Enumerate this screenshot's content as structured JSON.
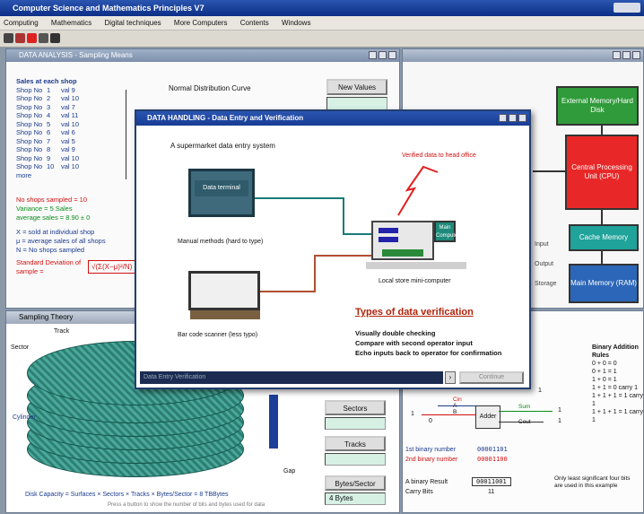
{
  "app": {
    "title": "Computer Science and Mathematics Principles V7"
  },
  "menu": [
    "Computing",
    "Mathematics",
    "Digital techniques",
    "More Computers",
    "Contents",
    "Windows"
  ],
  "left_window": {
    "title": "DATA ANALYSIS - Sampling Means",
    "sizes_header": "Sales at each shop",
    "steps": [
      {
        "label": "Shop No",
        "n": "1",
        "val": "val 9"
      },
      {
        "label": "Shop No",
        "n": "2",
        "val": "val 10"
      },
      {
        "label": "Shop No",
        "n": "3",
        "val": "val 7"
      },
      {
        "label": "Shop No",
        "n": "4",
        "val": "val 11"
      },
      {
        "label": "Shop No",
        "n": "5",
        "val": "val 10"
      },
      {
        "label": "Shop No",
        "n": "6",
        "val": "val 6"
      },
      {
        "label": "Shop No",
        "n": "7",
        "val": "val 5"
      },
      {
        "label": "Shop No",
        "n": "8",
        "val": "val 9"
      },
      {
        "label": "Shop No",
        "n": "9",
        "val": "val 10"
      },
      {
        "label": "Shop No",
        "n": "10",
        "val": "val 10"
      }
    ],
    "more": "more",
    "no_shops": "No shops sampled = 10",
    "variance": "Variance = 5 Sales",
    "average": "average sales = 8.90 ± 0",
    "def_x": "X = sold at individual shop",
    "def_mu": "μ = average sales of all shops",
    "def_n": "N = No shops sampled",
    "std_label": "Standard Deviation of sample =",
    "formula": "√(Σ(X−μ)²/N)",
    "chart_title": "Normal Distribution Curve",
    "new_values_button": "New Values"
  },
  "disk_window": {
    "title": "Sampling Theory",
    "sector_label": "Sector",
    "track_label": "Track",
    "cylinder_label": "Cylinder",
    "gap_label": "Gap",
    "formula": "Disk Capacity = Surfaces × Sectors × Tracks × Bytes/Sector = 8 TBBytes",
    "note": "Press a button to show the number of bits and bytes used for data",
    "buttons": [
      "Sectors",
      "Tracks",
      "Bytes/Sector"
    ],
    "bytes_field": "4 Bytes"
  },
  "cpu_window": {
    "blocks": [
      "External Memory/Hard Disk",
      "Central Processing Unit (CPU)",
      "Cache Memory",
      "Main Memory (RAM)"
    ],
    "side_labels": [
      "Input",
      "Output",
      "Storage"
    ]
  },
  "adder_window": {
    "binary_rules_title": "Binary Addition Rules",
    "rules": [
      "0 + 0 = 0",
      "0 + 1 = 1",
      "1 + 0 = 1",
      "1 + 1 = 0 carry 1",
      "1 + 1 + 1 = 1 carry 1",
      "1 + 1 + 1 = 1 carry 1"
    ],
    "adder_label": "Adder",
    "in_labels": [
      "Cin",
      "A",
      "B"
    ],
    "out_labels": [
      "Sum",
      "Cout"
    ],
    "bit_values": [
      "1",
      "0",
      "1",
      "1",
      "1"
    ],
    "first_binary_label": "1st binary number",
    "first_binary_value": "00001101",
    "second_binary_label": "2nd binary number",
    "second_binary_value": "00001100",
    "answer_label": "A binary Result",
    "answer_value": "00011001",
    "carry_label": "Carry Bits",
    "carry_value": "11",
    "note": "Only least significant four bits are used in this example"
  },
  "dialog": {
    "title": "DATA HANDLING - Data Entry and Verification",
    "heading": "A supermarket data entry system",
    "device_terminal": "Data terminal",
    "label_manual": "Manual methods (hard to type)",
    "label_barcode": "Bar code scanner (less typo)",
    "label_computer": "Local store mini-computer",
    "label_head_office": "Verified data to head office",
    "mainframe_label": "Main Computer",
    "verify_title": "Types of data verification",
    "verify_items": [
      "Visually double checking",
      "Compare with second operator input",
      "Echo inputs back to operator for confirmation"
    ],
    "scroll_left": "Data Entry Verification",
    "ok_button": "Continue"
  }
}
